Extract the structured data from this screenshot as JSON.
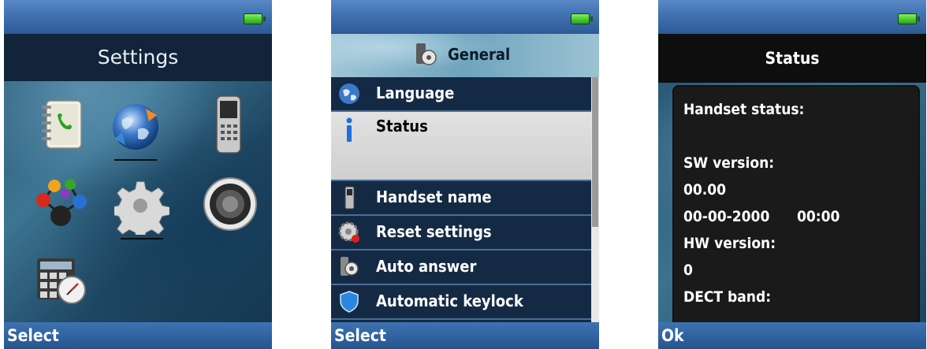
{
  "settings_screen": {
    "title": "Settings",
    "softkey": "Select",
    "icons": [
      "contacts-book-icon",
      "globe-sync-icon",
      "handset-icon",
      "molecule-network-icon",
      "gear-icon",
      "speaker-icon",
      "calculator-timer-icon"
    ]
  },
  "general_screen": {
    "title": "General",
    "softkey": "Select",
    "menu": [
      {
        "label": "Language",
        "icon": "globe-icon"
      },
      {
        "label": "Status",
        "icon": "info-icon"
      },
      {
        "label": "Handset name",
        "icon": "handset-icon"
      },
      {
        "label": "Reset settings",
        "icon": "gear-reset-icon"
      },
      {
        "label": "Auto answer",
        "icon": "handset-gear-icon"
      },
      {
        "label": "Automatic keylock",
        "icon": "shield-icon"
      }
    ],
    "selected_index": 1
  },
  "status_screen": {
    "title": "Status",
    "softkey": "Ok",
    "lines": {
      "handset_status": "Handset status:",
      "sw_version_label": "SW version:",
      "sw_version_value": "00.00",
      "sw_date": "00-00-2000",
      "sw_time": "00:00",
      "hw_version_label": "HW version:",
      "hw_version_value": "0",
      "dect_band_label": "DECT band:"
    }
  },
  "colors": {
    "softkey_bar": "#2f62a0",
    "selected_item": "#d8d8d8",
    "battery": "#3cc21e"
  }
}
